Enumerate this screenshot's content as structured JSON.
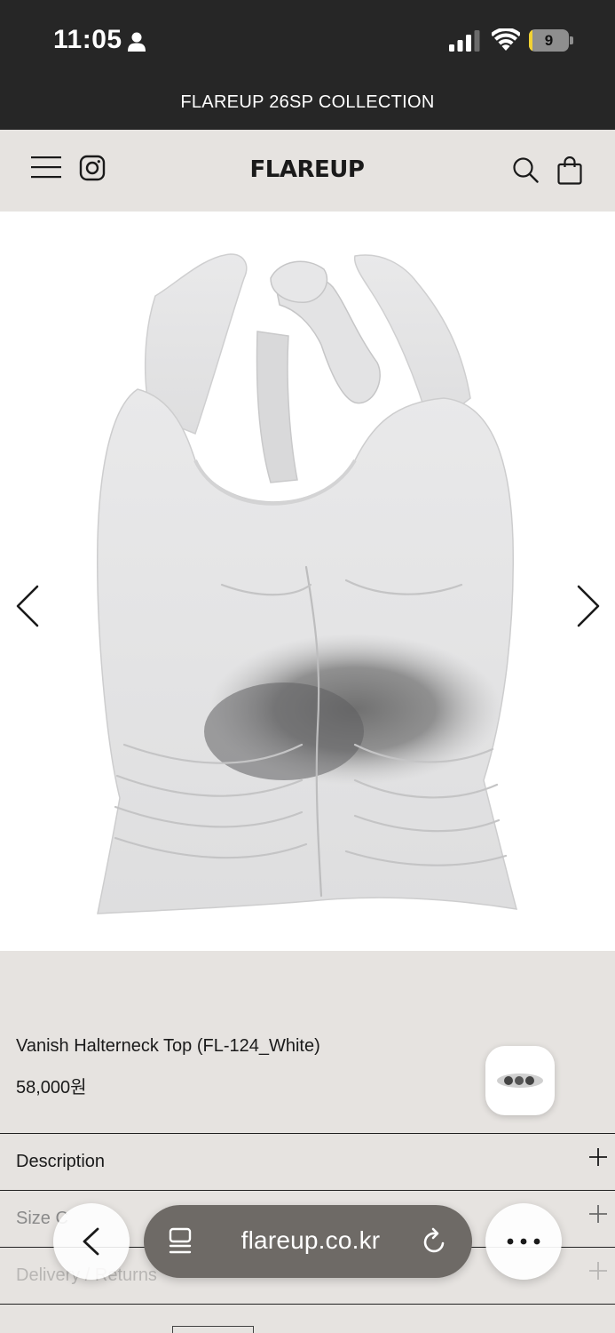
{
  "status_bar": {
    "time": "11:05",
    "battery_level": "9",
    "battery_fraction": 0.09
  },
  "announcement": "FLAREUP 26SP COLLECTION",
  "header": {
    "logo": "FLAREUP"
  },
  "product": {
    "name": "Vanish Halterneck Top (FL-124_White)",
    "price": "58,000원"
  },
  "accordion": [
    {
      "label": "Description"
    },
    {
      "label": "Size C"
    },
    {
      "label": "Delivery / Returns"
    }
  ],
  "browser": {
    "url": "flareup.co.kr"
  },
  "colors": {
    "dark_bar": "#262626",
    "page_bg": "#e6e3e0",
    "url_pill": "#6e6a66",
    "battery_yellow": "#f2d233"
  },
  "icons": [
    "person-icon",
    "signal-icon",
    "wifi-icon",
    "battery-icon",
    "menu-icon",
    "instagram-icon",
    "search-icon",
    "bag-icon",
    "chevron-left-icon",
    "chevron-right-icon",
    "chat-icon",
    "plus-icon",
    "tabs-icon",
    "reload-icon",
    "more-icon"
  ]
}
